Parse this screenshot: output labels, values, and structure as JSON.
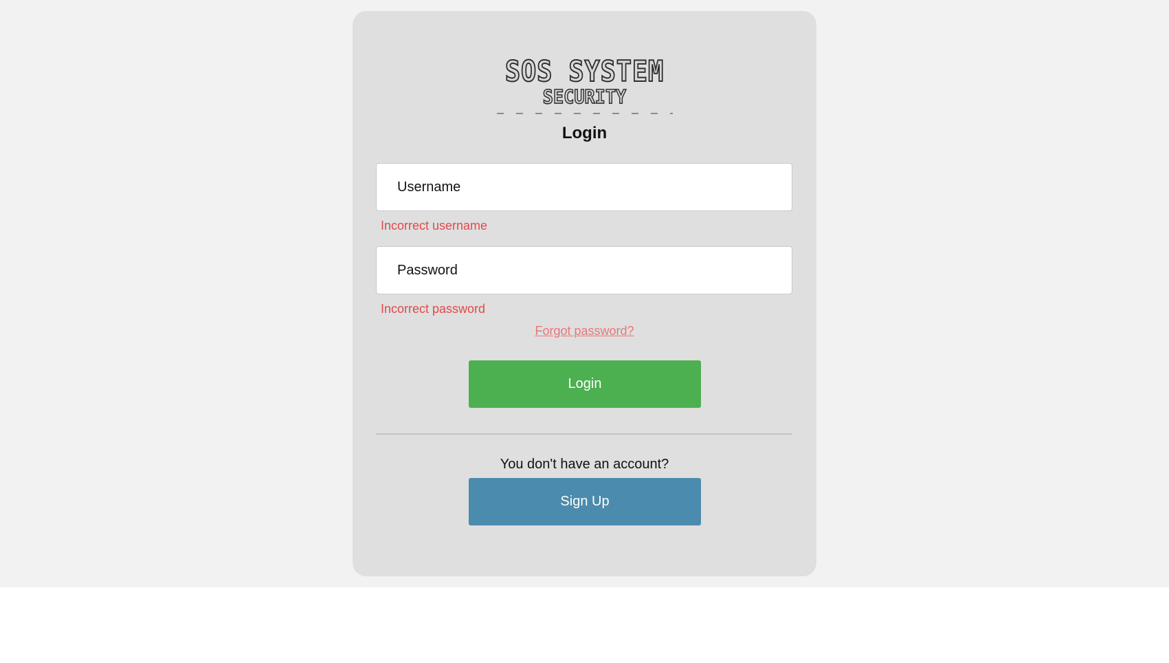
{
  "logo": {
    "line1": "SOS SYSTEM",
    "line2": "SECURITY"
  },
  "form": {
    "title": "Login",
    "username_placeholder": "Username",
    "username_error": "Incorrect username",
    "password_placeholder": "Password",
    "password_error": "Incorrect password",
    "forgot_label": "Forgot password?",
    "login_label": "Login"
  },
  "signup": {
    "prompt": "You don't have an account?",
    "button_label": "Sign Up"
  },
  "colors": {
    "page_background": "#f2f2f2",
    "card_background": "#dfdfdf",
    "error": "#e04a4a",
    "link": "#e8777a",
    "login_button": "#4caf50",
    "signup_button": "#4b8bad"
  }
}
